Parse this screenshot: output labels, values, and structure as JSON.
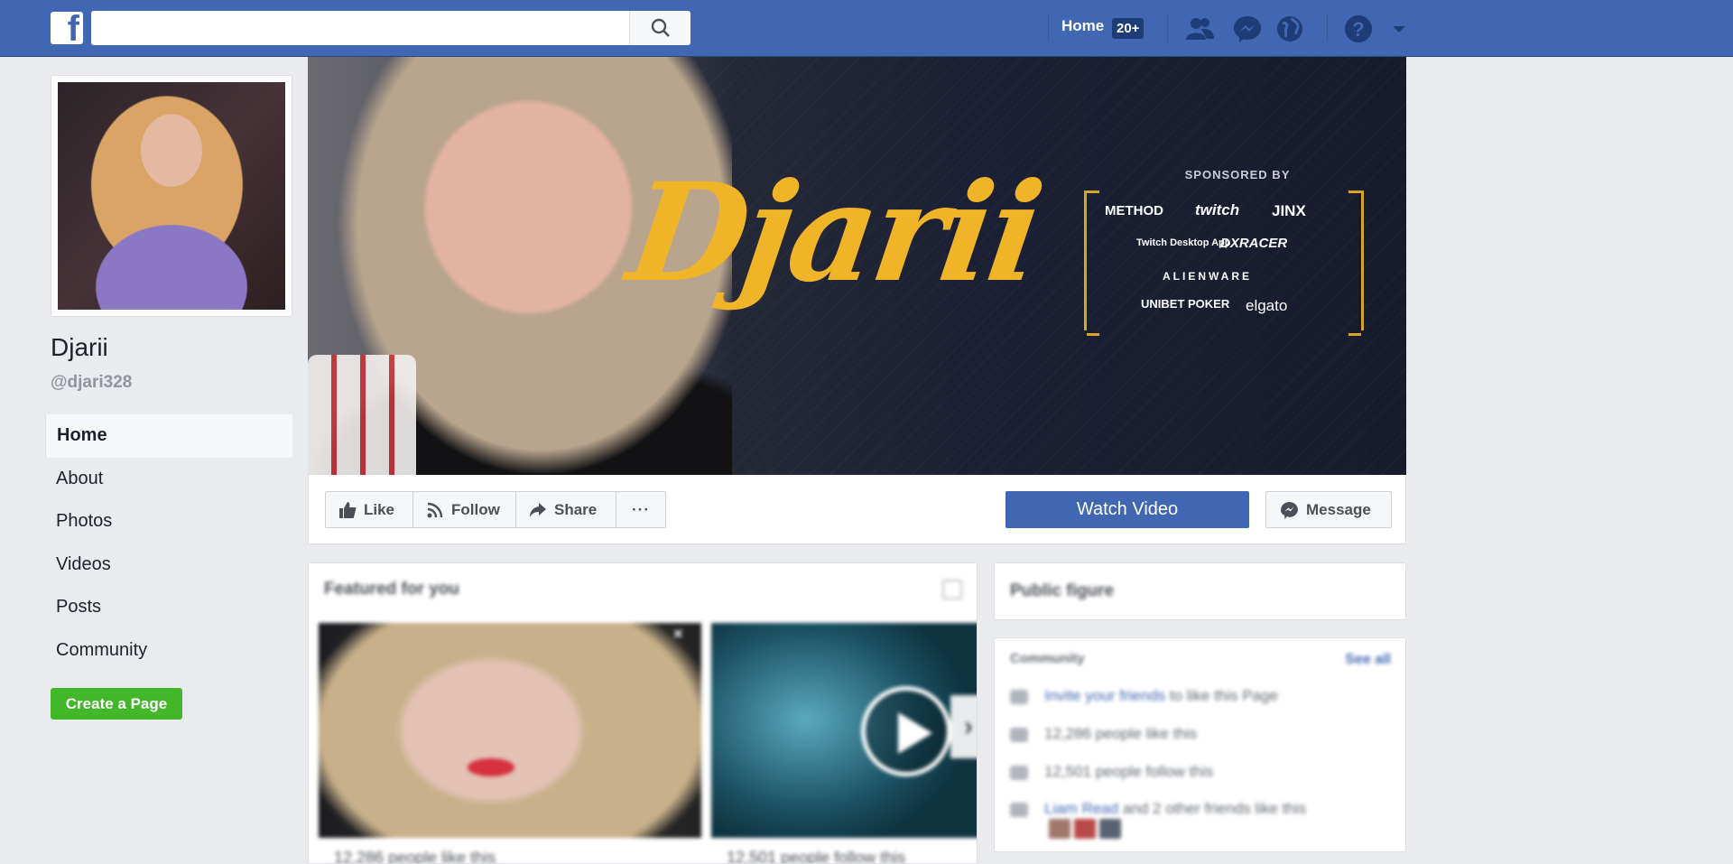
{
  "topbar": {
    "logo_letter": "f",
    "search_placeholder": "",
    "home_label": "Home",
    "home_badge": "20+",
    "icons": [
      "friends-icon",
      "messenger-icon",
      "notifications-globe-icon",
      "help-icon",
      "chevron-down-icon"
    ]
  },
  "profile": {
    "name": "Djarii",
    "handle": "@djari328"
  },
  "side_nav": [
    {
      "label": "Home",
      "active": true
    },
    {
      "label": "About"
    },
    {
      "label": "Photos"
    },
    {
      "label": "Videos"
    },
    {
      "label": "Posts"
    },
    {
      "label": "Community"
    }
  ],
  "create_page_label": "Create a Page",
  "cover": {
    "title": "Djarii",
    "sponsored_by": "SPONSORED BY",
    "sponsors": [
      "METHOD",
      "twitch",
      "JINX",
      "Twitch Desktop App",
      "DXRACER",
      "ALIENWARE",
      "UNIBET POKER",
      "elgato"
    ]
  },
  "actions": {
    "like": "Like",
    "follow": "Follow",
    "share": "Share",
    "more": "···",
    "watch_video": "Watch Video",
    "message": "Message"
  },
  "featured": {
    "title": "Featured for you",
    "card1_caption": "12,286 people like this",
    "card2_caption": "12,501 people follow this"
  },
  "public_figure": "Public figure",
  "community": {
    "title": "Community",
    "see_all": "See all",
    "invite_link": "Invite your friends",
    "invite_rest": " to like this Page",
    "likes": "12,286 people like this",
    "follows": "12,501 people follow this",
    "friend_link": "Liam Read",
    "friend_rest": " and 2 other friends like this"
  },
  "colors": {
    "brand": "#4267b2",
    "accent_gold": "#f0b429",
    "create_green": "#42b72a"
  }
}
